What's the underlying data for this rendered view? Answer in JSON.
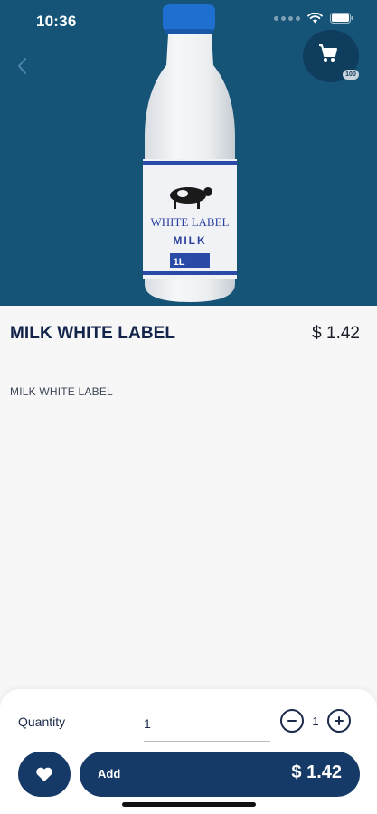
{
  "status_bar": {
    "time": "10:36",
    "icons": [
      "signal-dots-icon",
      "wifi-icon",
      "battery-icon"
    ]
  },
  "header": {
    "back_icon": "chevron-left-icon",
    "cart_icon": "shopping-cart-icon",
    "cart_badge": "100"
  },
  "product_image": {
    "brand_text": "WHITE LABEL",
    "type_text": "MILK",
    "size_text": "1L"
  },
  "product": {
    "title": "MILK WHITE LABEL",
    "price": "$ 1.42",
    "description": "MILK WHITE LABEL"
  },
  "quantity": {
    "label": "Quantity",
    "input_value": "1",
    "stepper_value": "1",
    "decrement_icon": "minus-circle-icon",
    "increment_icon": "plus-circle-icon"
  },
  "actions": {
    "favorite_icon": "heart-icon",
    "add_label": "Add",
    "add_price": "$ 1.42"
  },
  "colors": {
    "hero_background": "#155377",
    "primary_button": "#163a67",
    "title_text": "#13244a",
    "page_background": "#f7f7f8"
  }
}
